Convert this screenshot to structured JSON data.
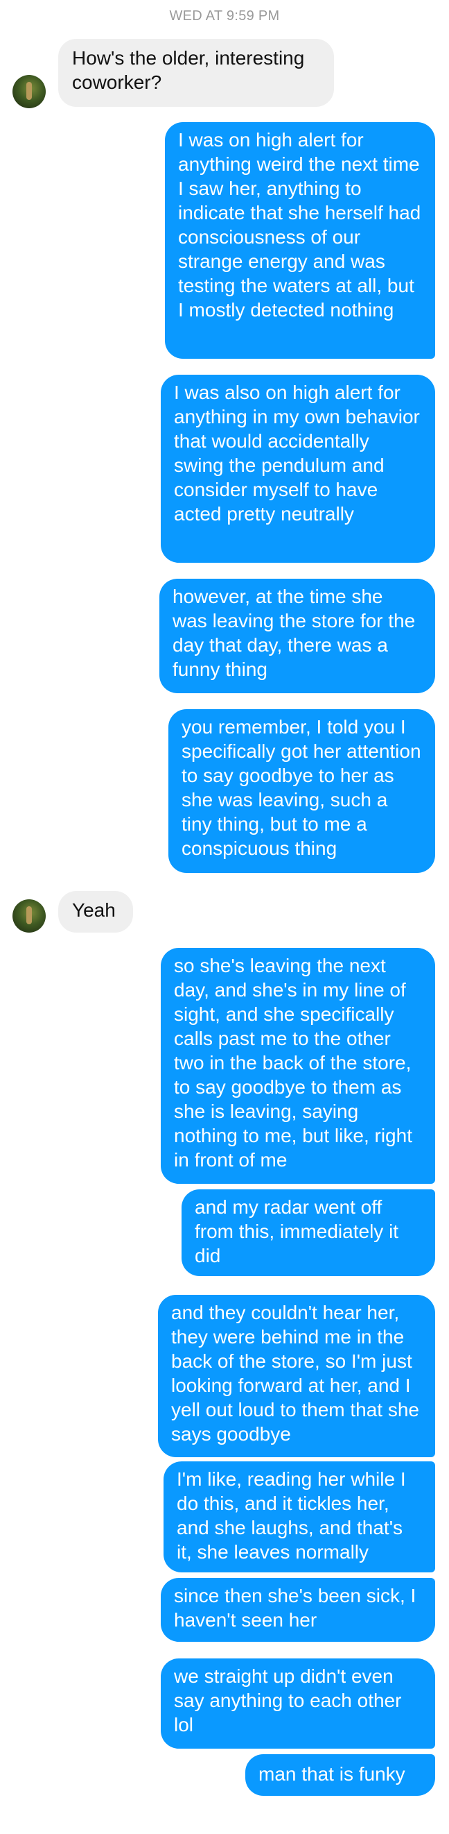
{
  "thread": {
    "timestamp": "WED AT 9:59 PM",
    "messages": [
      {
        "from": "them",
        "text": "How's the older, interesting coworker?"
      },
      {
        "from": "me",
        "text": "I was on high alert for anything weird the next time I saw her, anything to indicate that she herself had consciousness of our strange energy and was testing the waters at all, but I mostly detected nothing"
      },
      {
        "from": "me",
        "text": "I was also on high alert for anything in my own behavior that would accidentally swing the pendulum and consider myself to have acted pretty neutrally"
      },
      {
        "from": "me",
        "text": "however, at the time she was leaving the store for the day that day, there was a funny thing"
      },
      {
        "from": "me",
        "text": "you remember, I told you I specifically got her attention to say goodbye to her as she was leaving, such a tiny thing, but to me a conspicuous thing"
      },
      {
        "from": "them",
        "text": "Yeah"
      },
      {
        "from": "me",
        "text": "so she's leaving the next day, and she's in my line of sight, and she specifically calls past me to the other two in the back of the store, to say goodbye to them as she is leaving, saying nothing to me, but like, right in front of me"
      },
      {
        "from": "me",
        "text": "and my radar went off from this, immediately it did"
      },
      {
        "from": "me",
        "text": "and they couldn't hear her, they were behind me in the back of the store, so I'm just looking forward at her, and I yell out loud to them that she says goodbye"
      },
      {
        "from": "me",
        "text": "I'm like, reading her while I do this, and it tickles her, and she laughs, and that's it, she leaves normally"
      },
      {
        "from": "me",
        "text": "since then she's been sick, I haven't seen her"
      },
      {
        "from": "me",
        "text": "we straight up didn't even say anything to each other lol"
      },
      {
        "from": "me",
        "text": "man that is funky"
      }
    ]
  },
  "colors": {
    "outgoing_bubble": "#0a99ff",
    "incoming_bubble": "#efefef",
    "timestamp_text": "#9a9a9a"
  }
}
